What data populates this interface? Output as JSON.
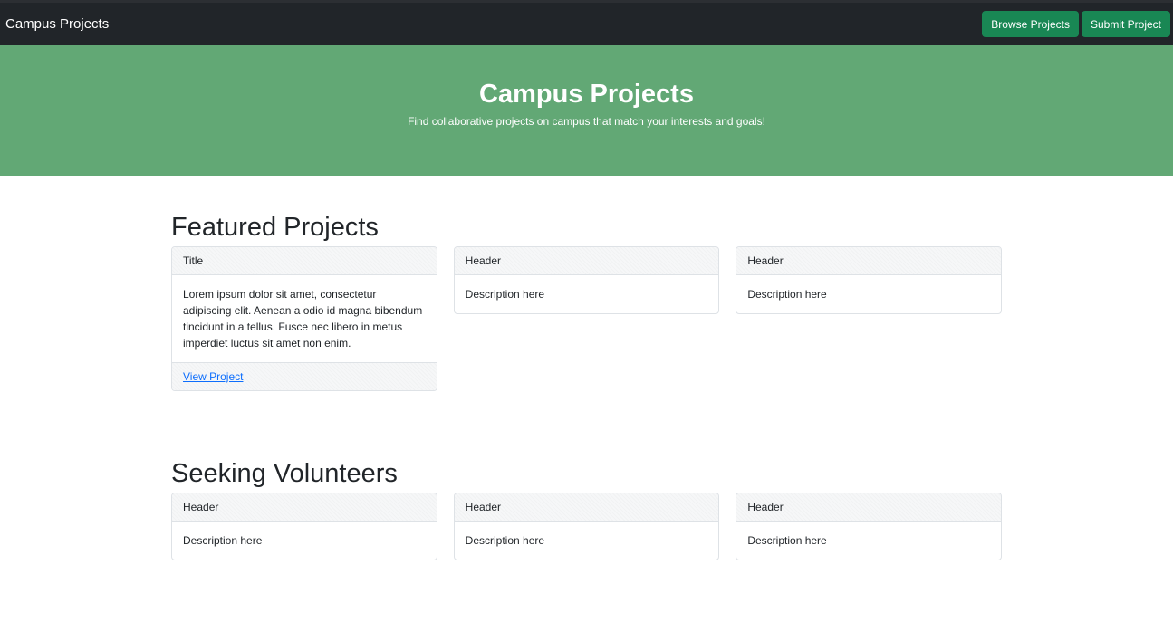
{
  "navbar": {
    "brand": "Campus Projects",
    "browse_label": "Browse Projects",
    "submit_label": "Submit Project"
  },
  "hero": {
    "title": "Campus Projects",
    "subtitle": "Find collaborative projects on campus that match your interests and goals!"
  },
  "featured": {
    "title": "Featured Projects",
    "cards": [
      {
        "header": "Title",
        "body": "Lorem ipsum dolor sit amet, consectetur adipiscing elit. Aenean a odio id magna bibendum tincidunt in a tellus. Fusce nec libero in metus imperdiet luctus sit amet non enim.",
        "link": "View Project"
      },
      {
        "header": "Header",
        "body": "Description here"
      },
      {
        "header": "Header",
        "body": "Description here"
      }
    ]
  },
  "volunteers": {
    "title": "Seeking Volunteers",
    "cards": [
      {
        "header": "Header",
        "body": "Description here"
      },
      {
        "header": "Header",
        "body": "Description here"
      },
      {
        "header": "Header",
        "body": "Description here"
      }
    ]
  },
  "colors": {
    "navbar_bg": "#212529",
    "button_bg": "#198754",
    "hero_bg": "#62a875",
    "link": "#0d6efd"
  }
}
